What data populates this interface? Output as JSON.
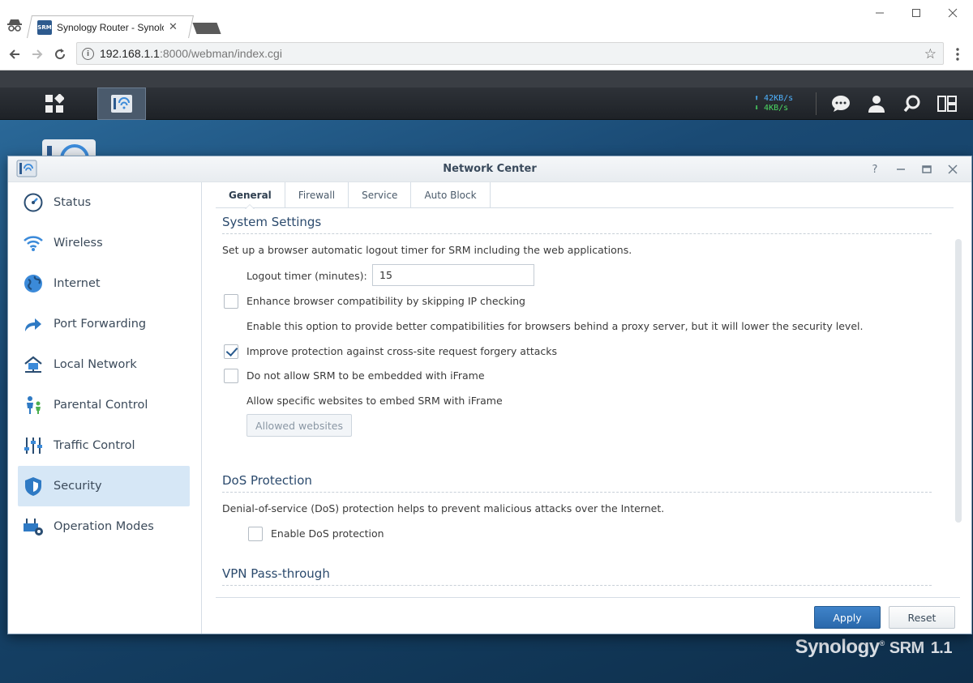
{
  "browser": {
    "tab_title": "Synology Router - Synology",
    "favicon_text": "SRM",
    "url_host": "192.168.1.1",
    "url_rest": ":8000/webman/index.cgi"
  },
  "taskbar": {
    "upload_rate": "42KB/s",
    "download_rate": "4KB/s"
  },
  "window": {
    "title": "Network Center"
  },
  "sidebar": {
    "items": [
      {
        "label": "Status",
        "icon": "gauge-icon"
      },
      {
        "label": "Wireless",
        "icon": "wifi-icon"
      },
      {
        "label": "Internet",
        "icon": "globe-icon"
      },
      {
        "label": "Port Forwarding",
        "icon": "arrow-forward-icon"
      },
      {
        "label": "Local Network",
        "icon": "home-network-icon"
      },
      {
        "label": "Parental Control",
        "icon": "family-icon"
      },
      {
        "label": "Traffic Control",
        "icon": "sliders-icon"
      },
      {
        "label": "Security",
        "icon": "shield-icon",
        "active": true
      },
      {
        "label": "Operation Modes",
        "icon": "router-gear-icon"
      }
    ]
  },
  "tabs": [
    "General",
    "Firewall",
    "Service",
    "Auto Block"
  ],
  "system": {
    "heading": "System Settings",
    "desc": "Set up a browser automatic logout timer for SRM including the web applications.",
    "logout_label": "Logout timer (minutes):",
    "logout_value": "15",
    "enhance_label": "Enhance browser compatibility by skipping IP checking",
    "enhance_checked": false,
    "enhance_hint": "Enable this option to provide better compatibilities for browsers behind a proxy server, but it will lower the security level.",
    "csrf_label": "Improve protection against cross-site request forgery attacks",
    "csrf_checked": true,
    "iframe_label": "Do not allow SRM to be embedded with iFrame",
    "iframe_checked": false,
    "iframe_hint": "Allow specific websites to embed SRM with iFrame",
    "allowed_button": "Allowed websites"
  },
  "dos": {
    "heading": "DoS Protection",
    "desc": "Denial-of-service (DoS) protection helps to prevent malicious attacks over the Internet.",
    "enable_label": "Enable DoS protection",
    "enable_checked": false
  },
  "vpn": {
    "heading": "VPN Pass-through"
  },
  "footer": {
    "apply": "Apply",
    "reset": "Reset"
  },
  "brand": {
    "name": "Synology",
    "product": "SRM",
    "version": "1.1"
  },
  "colors": {
    "accent": "#2a68ab",
    "active_nav": "#d6e7f6",
    "upload_rate": "#4fb3ff",
    "download_rate": "#4cd964"
  }
}
